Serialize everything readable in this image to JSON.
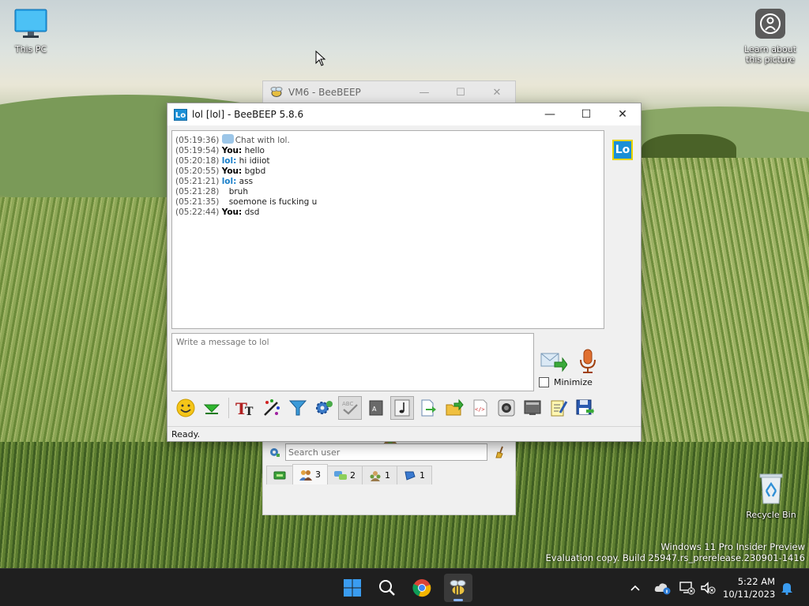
{
  "desktop": {
    "icons": [
      {
        "name": "this-pc",
        "label": "This PC"
      },
      {
        "name": "learn-about-picture",
        "label": "Learn about\nthis picture"
      },
      {
        "name": "recycle-bin",
        "label": "Recycle Bin"
      }
    ],
    "watermark": {
      "line1": "Windows 11 Pro Insider Preview",
      "line2": "Evaluation copy. Build 25947.rs_prerelease.230901-1416"
    }
  },
  "back_window": {
    "title": "VM6 - BeeBEEP",
    "search_placeholder": "Search user",
    "tabs": [
      {
        "icon": "users-icon",
        "count": "3",
        "active": true
      },
      {
        "icon": "chats-icon",
        "count": "2",
        "active": false
      },
      {
        "icon": "groups-icon",
        "count": "1",
        "active": false
      },
      {
        "icon": "shares-icon",
        "count": "1",
        "active": false
      }
    ]
  },
  "chat_window": {
    "title": "lol [lol] - BeeBEEP 5.8.6",
    "app_icon_text": "Lo",
    "avatar_text": "Lo",
    "messages": [
      {
        "ts": "(05:19:36)",
        "sender": "",
        "kind": "sys",
        "text": "Chat with lol."
      },
      {
        "ts": "(05:19:54)",
        "sender": "You:",
        "kind": "you",
        "text": " hello"
      },
      {
        "ts": "(05:20:18)",
        "sender": "lol:",
        "kind": "lol",
        "text": " hi idiiot"
      },
      {
        "ts": "(05:20:55)",
        "sender": "You:",
        "kind": "you",
        "text": " bgbd"
      },
      {
        "ts": "(05:21:21)",
        "sender": "lol:",
        "kind": "lol",
        "text": " ass"
      },
      {
        "ts": "(05:21:28)",
        "sender": "",
        "kind": "cont",
        "text": "bruh"
      },
      {
        "ts": "(05:21:35)",
        "sender": "",
        "kind": "cont",
        "text": "soemone is fucking u"
      },
      {
        "ts": "(05:22:44)",
        "sender": "You:",
        "kind": "you",
        "text": " dsd"
      }
    ],
    "input_placeholder": "Write a message to lol",
    "minimize_label": "Minimize",
    "status": "Ready."
  },
  "taskbar": {
    "time": "5:22 AM",
    "date": "10/11/2023"
  },
  "colors": {
    "accent": "#1a8fd6",
    "taskbar": "#1f1f1f",
    "avatar_border": "#e6d400"
  }
}
